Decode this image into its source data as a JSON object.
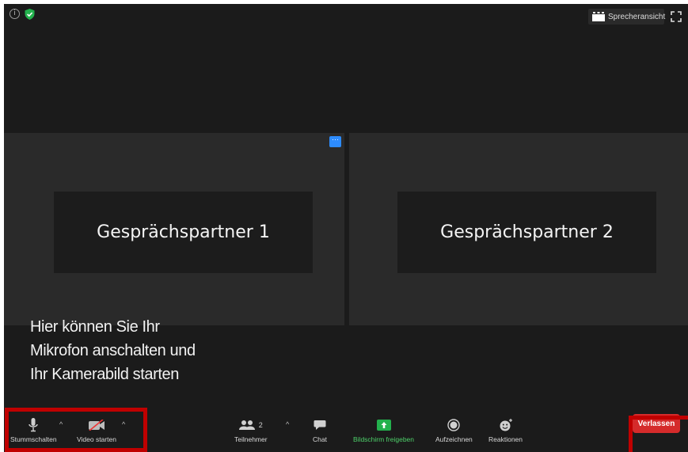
{
  "top_bar": {
    "speaker_view_label": "Sprecheransicht"
  },
  "participants": [
    {
      "name": "Gesprächspartner 1"
    },
    {
      "name": "Gesprächspartner 2"
    }
  ],
  "tile_menu_label": "···",
  "annotation": {
    "lines": [
      "Hier können Sie Ihr",
      "Mikrofon anschalten und",
      "Ihr Kamerabild starten"
    ]
  },
  "toolbar": {
    "mute_label": "Stummschalten",
    "video_label": "Video starten",
    "participants_label": "Teilnehmer",
    "participants_count": "2",
    "chat_label": "Chat",
    "share_label": "Bildschirm freigeben",
    "record_label": "Aufzeichnen",
    "reactions_label": "Reaktionen",
    "chevron": "^",
    "leave_label": "Verlassen"
  },
  "colors": {
    "background": "#1b1b1b",
    "tile": "#2a2a2a",
    "share_green": "#4ed06a",
    "leave_red": "#d52b2b",
    "highlight_red": "#c00000",
    "accent_blue": "#2d8cff"
  }
}
